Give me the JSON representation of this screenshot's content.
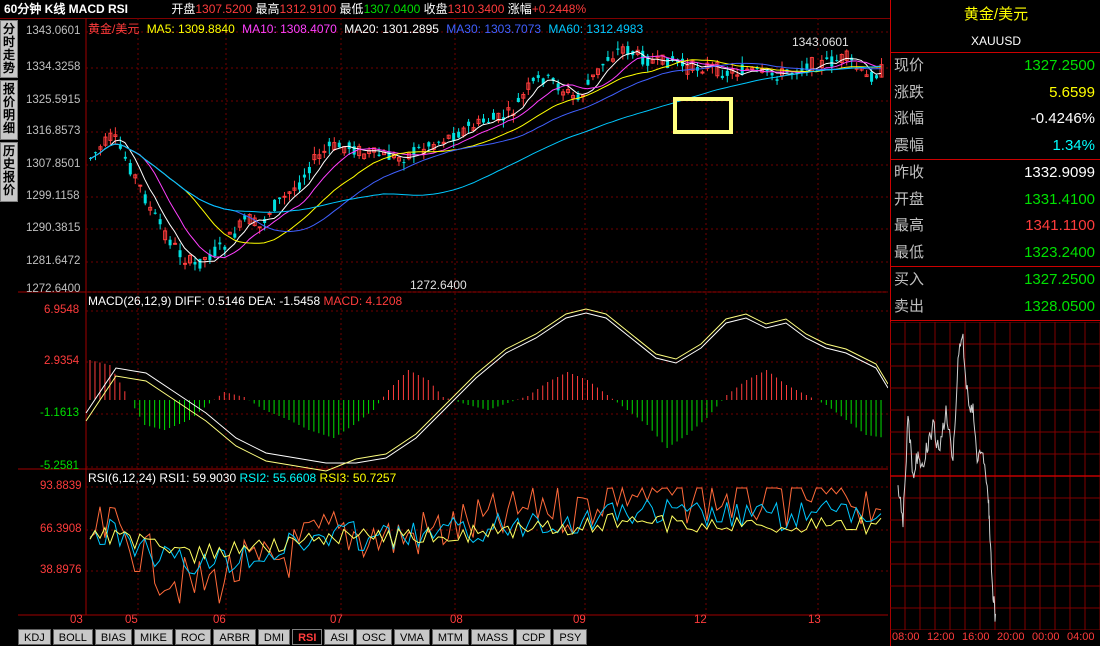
{
  "header": {
    "title": "60分钟 K线 MACD RSI",
    "open_label": "开盘",
    "open": "1307.5200",
    "high_label": "最高",
    "high": "1312.9100",
    "low_label": "最低",
    "low": "1307.0400",
    "close_label": "收盘",
    "close": "1310.3400",
    "change_label": "涨幅",
    "change": "+0.2448%"
  },
  "side_tabs": [
    "分时走势",
    "报价明细",
    "历史报价"
  ],
  "price_panel": {
    "legend_name": "黄金/美元",
    "ma5": "MA5: 1309.8840",
    "ma10": "MA10: 1308.4070",
    "ma20": "MA20: 1301.2895",
    "ma30": "MA30: 1303.7073",
    "ma60": "MA60: 1312.4983",
    "y_ticks": [
      "1343.0601",
      "1334.3258",
      "1325.5915",
      "1316.8573",
      "1307.8501",
      "1299.1158",
      "1290.3815",
      "1281.6472",
      "1272.6400"
    ],
    "max_label": "1343.0601",
    "min_label": "1272.6400"
  },
  "macd_panel": {
    "title": "MACD(26,12,9)",
    "diff": "DIFF: 0.5146",
    "dea": "DEA: -1.5458",
    "macd": "MACD: 4.1208",
    "y_ticks": [
      "6.9548",
      "2.9354",
      "-1.1613",
      "-5.2581"
    ]
  },
  "rsi_panel": {
    "title": "RSI(6,12,24)",
    "rsi1": "RSI1: 59.9030",
    "rsi2": "RSI2: 55.6608",
    "rsi3": "RSI3: 50.7257",
    "y_ticks": [
      "93.8839",
      "66.3908",
      "38.8976"
    ]
  },
  "x_ticks": [
    "03",
    "05",
    "06",
    "07",
    "08",
    "09",
    "12",
    "13"
  ],
  "bottom_tabs": [
    "KDJ",
    "BOLL",
    "BIAS",
    "MIKE",
    "ROC",
    "ARBR",
    "DMI",
    "RSI",
    "ASI",
    "OSC",
    "VMA",
    "MTM",
    "MASS",
    "CDP",
    "PSY"
  ],
  "active_tab": "RSI",
  "quote": {
    "name": "黄金/美元",
    "code": "XAUUSD",
    "rows": [
      {
        "k": "现价",
        "v": "1327.2500",
        "c": "#00e000"
      },
      {
        "k": "涨跌",
        "v": "5.6599",
        "c": "#ffff00"
      },
      {
        "k": "涨幅",
        "v": "-0.4246%",
        "c": "#ffffff"
      },
      {
        "k": "震幅",
        "v": "1.34%",
        "c": "#00ffff"
      }
    ],
    "rows2": [
      {
        "k": "昨收",
        "v": "1332.9099",
        "c": "#ffffff"
      },
      {
        "k": "开盘",
        "v": "1331.4100",
        "c": "#00e000"
      },
      {
        "k": "最高",
        "v": "1341.1100",
        "c": "#ff3c3c"
      },
      {
        "k": "最低",
        "v": "1323.2400",
        "c": "#00e000"
      }
    ],
    "rows3": [
      {
        "k": "买入",
        "v": "1327.2500",
        "c": "#00e000"
      },
      {
        "k": "卖出",
        "v": "1328.0500",
        "c": "#00e000"
      }
    ]
  },
  "mini_chart": {
    "x_ticks": [
      "08:00",
      "12:00",
      "16:00",
      "20:00",
      "00:00",
      "04:00"
    ]
  },
  "colors": {
    "up": "#ff3c3c",
    "down": "#00e0e0",
    "ma5": "#ffffff",
    "ma10": "#ff40ff",
    "ma20": "#ffff00",
    "ma30": "#4060ff",
    "ma60": "#00c8ff"
  }
}
